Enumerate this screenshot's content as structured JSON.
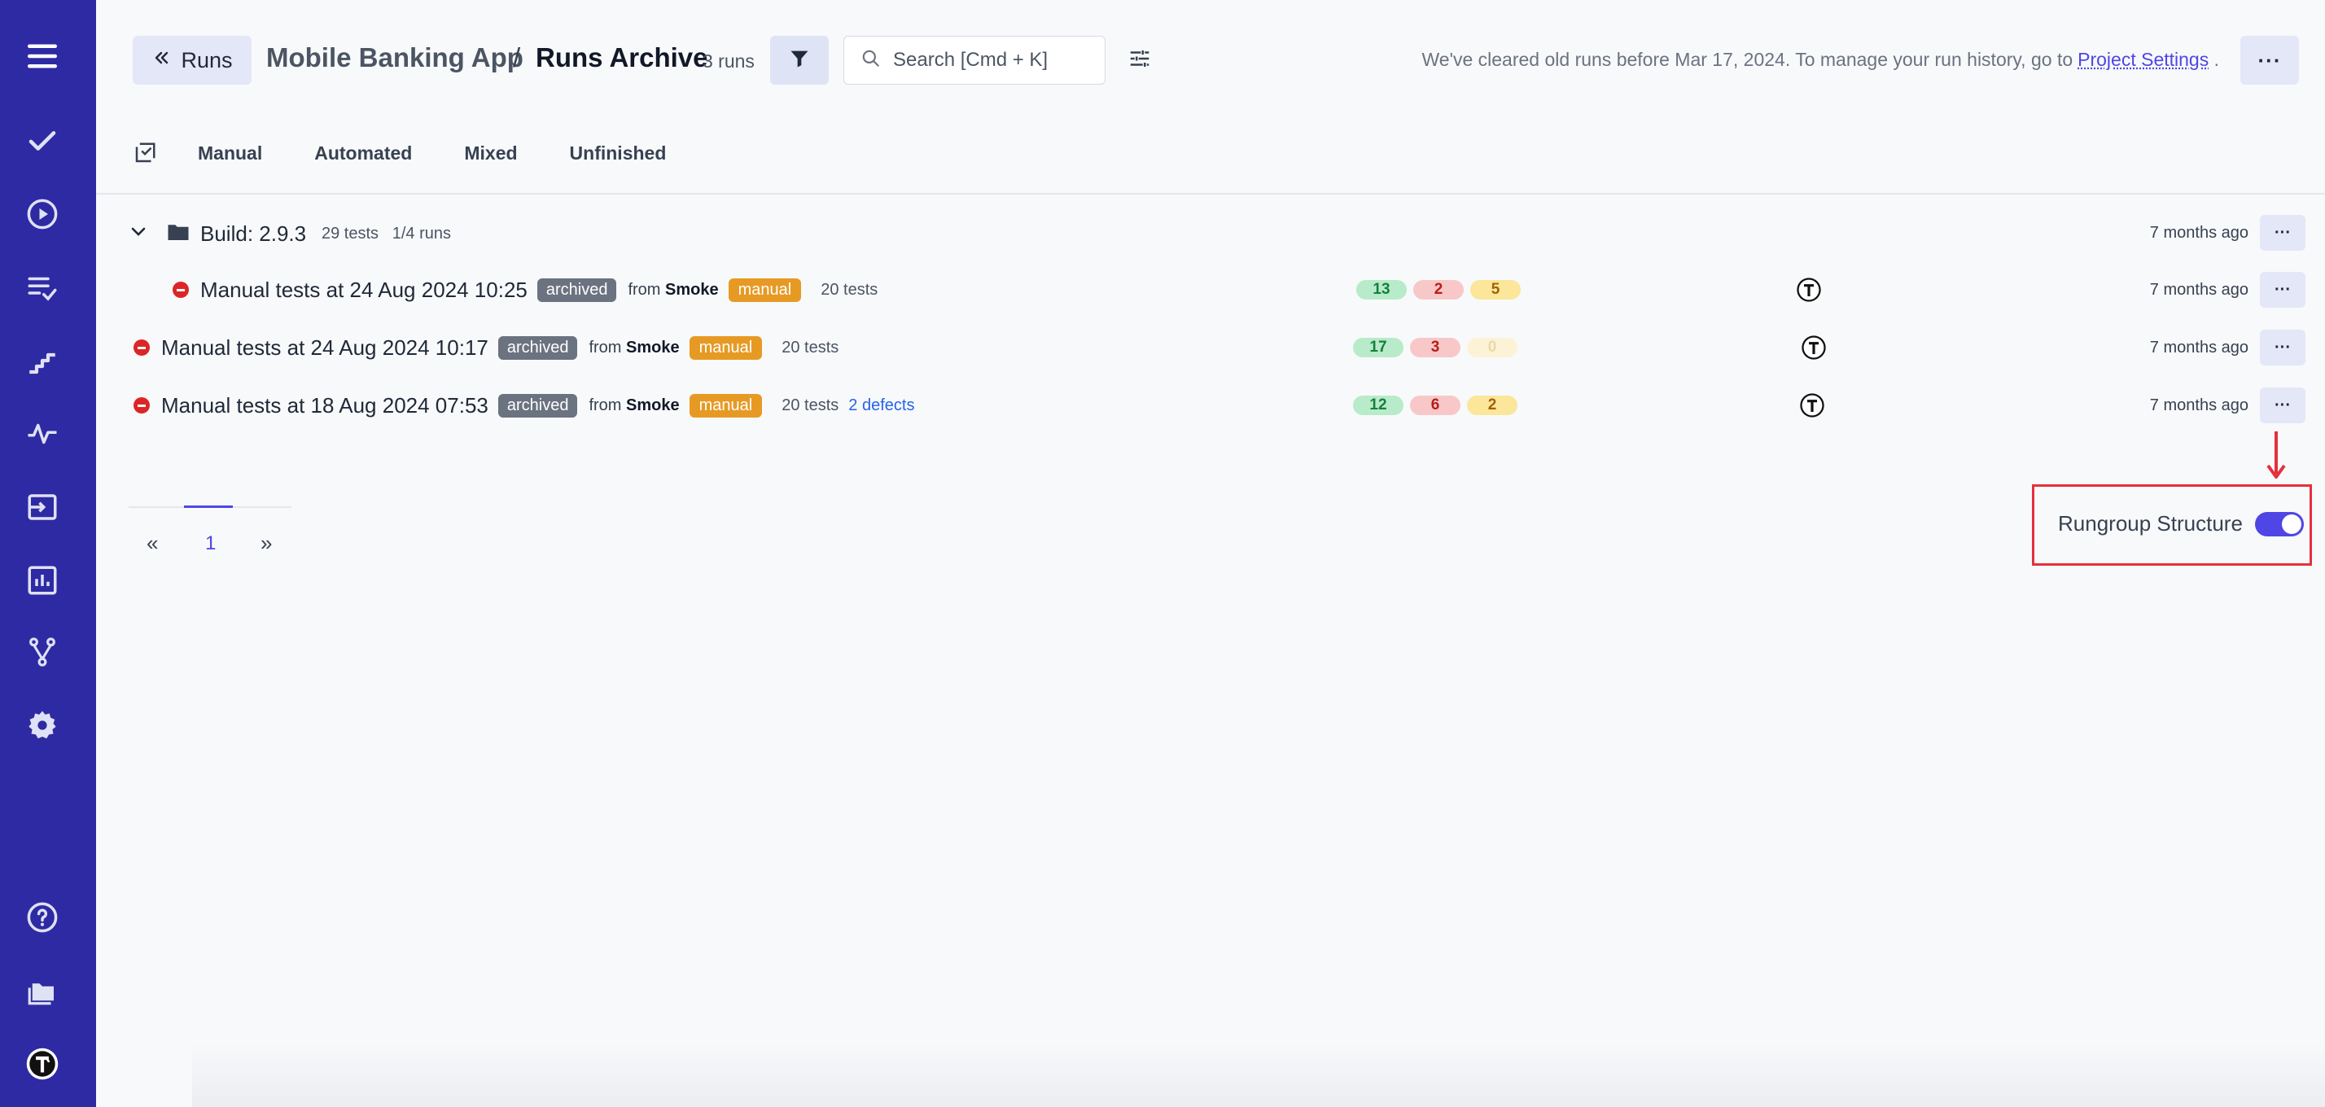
{
  "sidebar": {
    "items": [
      {
        "name": "menu-icon"
      },
      {
        "name": "check-icon"
      },
      {
        "name": "play-circle-icon"
      },
      {
        "name": "list-check-icon"
      },
      {
        "name": "steps-icon"
      },
      {
        "name": "pulse-icon"
      },
      {
        "name": "import-icon"
      },
      {
        "name": "chart-icon"
      },
      {
        "name": "branch-icon"
      },
      {
        "name": "gear-icon"
      },
      {
        "name": "help-icon"
      },
      {
        "name": "folders-icon"
      },
      {
        "name": "avatar-icon"
      }
    ],
    "bg_color": "#2e2aa3"
  },
  "header": {
    "back_label": "Runs",
    "project": "Mobile Banking App",
    "separator": "/",
    "page": "Runs Archive",
    "run_count": "3 runs",
    "search_placeholder": "Search [Cmd + K]",
    "notice": "We've cleared old runs before Mar 17, 2024. To manage your run history, go to",
    "notice_link": "Project Settings",
    "notice_end": ".",
    "more": "···"
  },
  "tabs": [
    "Manual",
    "Automated",
    "Mixed",
    "Unfinished"
  ],
  "group": {
    "title": "Build: 2.9.3",
    "tests": "29 tests",
    "runs": "1/4 runs",
    "time": "7 months ago"
  },
  "runs": [
    {
      "title": "Manual tests at 24 Aug 2024 10:25",
      "badge": "archived",
      "from": "from",
      "source": "Smoke",
      "type": "manual",
      "tests": "20 tests",
      "defects": "",
      "passed": "13",
      "failed": "2",
      "skipped": "5",
      "time": "7 months ago"
    },
    {
      "title": "Manual tests at 24 Aug 2024 10:17",
      "badge": "archived",
      "from": "from",
      "source": "Smoke",
      "type": "manual",
      "tests": "20 tests",
      "defects": "",
      "passed": "17",
      "failed": "3",
      "skipped": "0",
      "time": "7 months ago"
    },
    {
      "title": "Manual tests at 18 Aug 2024 07:53",
      "badge": "archived",
      "from": "from",
      "source": "Smoke",
      "type": "manual",
      "tests": "20 tests",
      "defects": "2 defects",
      "passed": "12",
      "failed": "6",
      "skipped": "2",
      "time": "7 months ago"
    }
  ],
  "pagination": {
    "prev": "«",
    "current": "1",
    "next": "»"
  },
  "rungroup": {
    "label": "Rungroup Structure",
    "enabled": true
  },
  "colors": {
    "accent": "#4f46e5",
    "annotation": "#e5303d",
    "manual_badge": "#e69a24",
    "archived_badge": "#6b7280"
  }
}
